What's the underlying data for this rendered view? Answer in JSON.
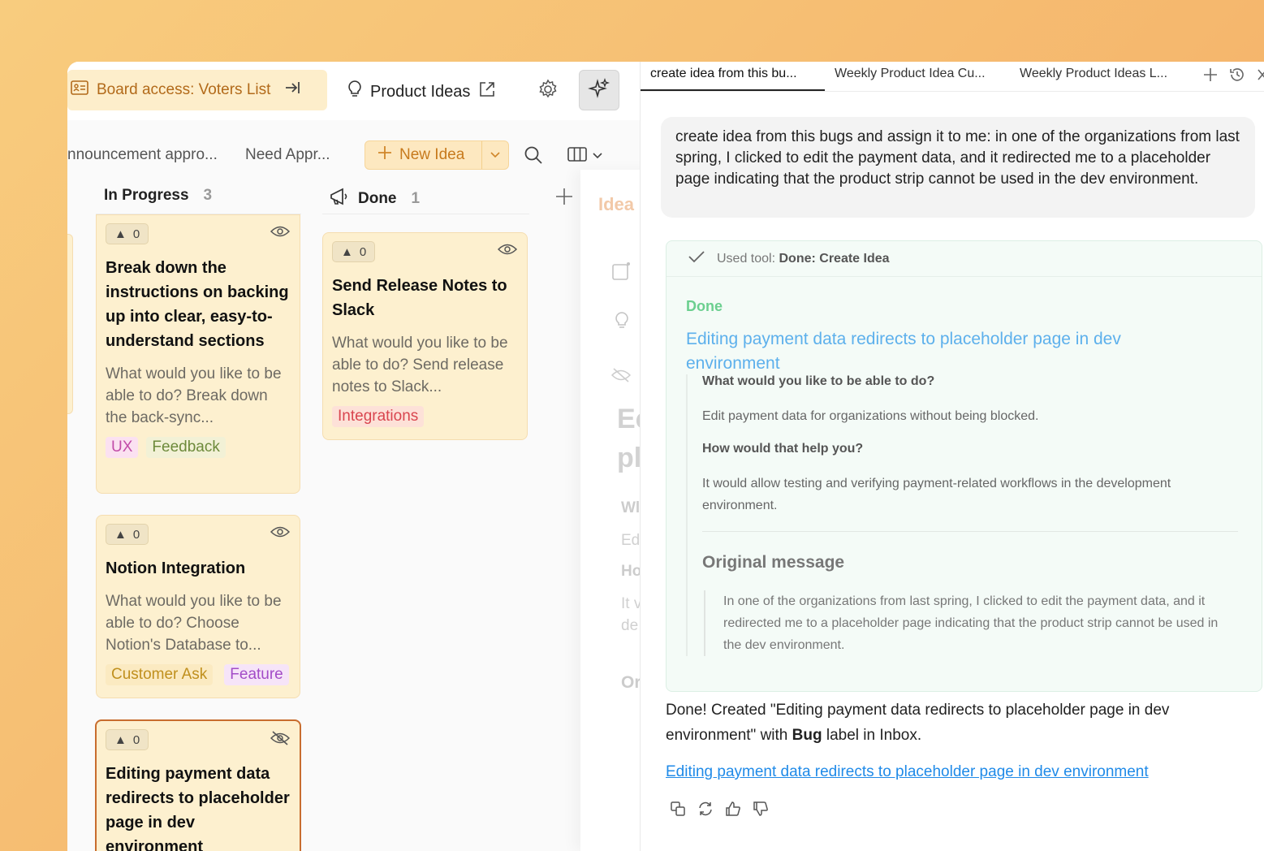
{
  "board": {
    "access_label": "Board access: Voters List",
    "product_ideas": "Product Ideas",
    "views": [
      "nnouncement appro...",
      "Need Appr..."
    ],
    "new_idea": "New Idea",
    "columns": [
      {
        "name": "In Progress",
        "count": "3"
      },
      {
        "name": "Done",
        "count": "1"
      }
    ],
    "in_progress_cards": [
      {
        "votes": "0",
        "title": "Break down the instructions on backing up into clear, easy-to-understand sections",
        "desc": "What would you like to be able to do? Break down the back-sync...",
        "tags": [
          "UX",
          "Feedback"
        ]
      },
      {
        "votes": "0",
        "title": "Notion Integration",
        "desc": "What would you like to be able to do? Choose Notion's Database to...",
        "tags": [
          "Customer Ask",
          "Feature"
        ]
      },
      {
        "votes": "0",
        "title": "Editing payment data redirects to placeholder page in dev environment"
      }
    ],
    "done_cards": [
      {
        "votes": "0",
        "title": "Send Release Notes to Slack",
        "desc": "What would you like to be able to do? Send release notes to Slack...",
        "tags": [
          "Integrations"
        ]
      }
    ],
    "faded_panel": {
      "title": "Idea",
      "ghost": [
        "Ec",
        "pl",
        "Wl",
        "Ed",
        "Ho",
        "It v",
        "de",
        "Or"
      ]
    }
  },
  "chat": {
    "tabs": [
      "create idea from this bu...",
      "Weekly Product Idea Cu...",
      "Weekly Product Ideas L..."
    ],
    "user_message": "create idea from this bugs and assign it to me: in one of the organizations from last spring, I clicked to edit the payment data, and it redirected me to a placeholder page indicating that the product strip cannot be used in the dev environment.",
    "tool": {
      "prefix": "Used tool:",
      "name": "Done: Create Idea",
      "status": "Done",
      "idea_title": "Editing payment data redirects to placeholder page in dev environment",
      "q1": "What would you like to be able to do?",
      "a1": "Edit payment data for organizations without being blocked.",
      "q2": "How would that help you?",
      "a2": "It would allow testing and verifying payment-related workflows in the development environment.",
      "orig_title": "Original message",
      "orig_text": "In one of the organizations from last spring, I clicked to edit the payment data, and it redirected me to a placeholder page indicating that the product strip cannot be used in the dev environment."
    },
    "reply": {
      "pre": "Done! Created \"Editing payment data redirects to placeholder page in dev environment\" with ",
      "bold": "Bug",
      "post": " label in Inbox."
    },
    "reply_link": "Editing payment data redirects to placeholder page in dev environment"
  }
}
